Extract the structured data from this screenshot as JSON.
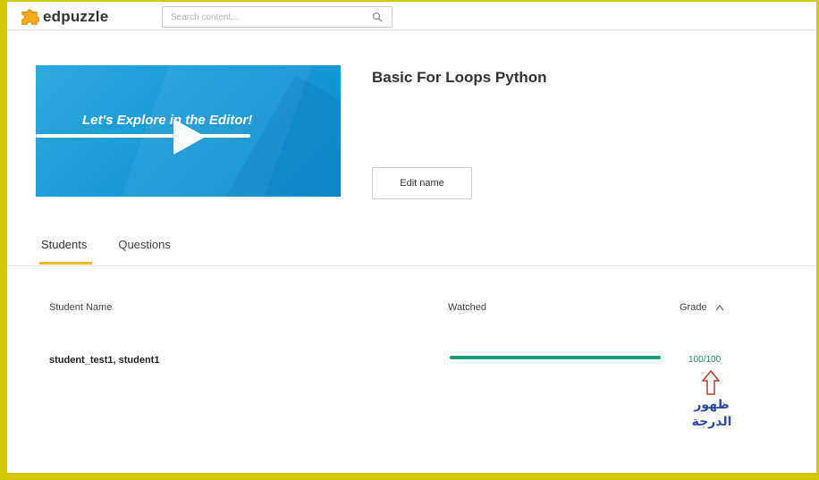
{
  "header": {
    "logo_text": "edpuzzle",
    "search_placeholder": "Search content..."
  },
  "video": {
    "thumbnail_text": "Let's Explore in the Editor!",
    "title": "Basic For Loops Python",
    "edit_label": "Edit name"
  },
  "tabs": [
    {
      "label": "Students",
      "active": true
    },
    {
      "label": "Questions",
      "active": false
    }
  ],
  "table": {
    "headers": {
      "name": "Student Name",
      "watched": "Watched",
      "grade": "Grade"
    },
    "rows": [
      {
        "name": "student_test1, student1",
        "watched_fraction": 1.0,
        "grade": "100/100"
      }
    ]
  },
  "annotation": {
    "line1": "ظهور",
    "line2": "الدرجة"
  },
  "colors": {
    "border": "#d4c900",
    "accent_tab": "#f2b622",
    "progress": "#139e7a",
    "grade": "#1f8a5e",
    "annotation_text": "#2e4aa6",
    "annotation_arrow": "#c0392b"
  }
}
